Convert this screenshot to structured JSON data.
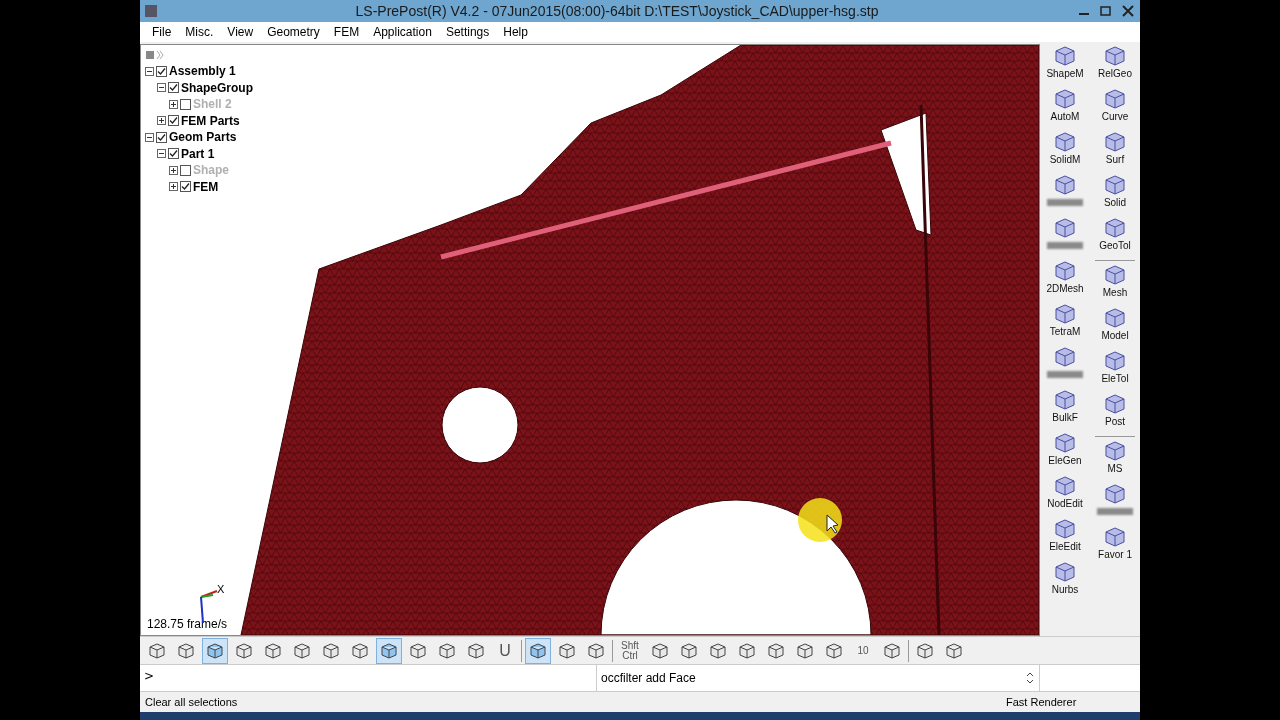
{
  "window": {
    "title": "LS-PrePost(R) V4.2 - 07Jun2015(08:00)-64bit D:\\TEST\\Joystick_CAD\\upper-hsg.stp"
  },
  "menu": [
    "File",
    "Misc.",
    "View",
    "Geometry",
    "FEM",
    "Application",
    "Settings",
    "Help"
  ],
  "tree": [
    {
      "label": "Assembly 1",
      "checked": true,
      "expanded": true,
      "children": [
        {
          "label": "ShapeGroup",
          "checked": true,
          "expanded": true,
          "children": [
            {
              "label": "Shell 2",
              "checked": false,
              "expanded": false
            }
          ]
        },
        {
          "label": "FEM Parts",
          "checked": true,
          "expanded": false
        }
      ]
    },
    {
      "label": "Geom Parts",
      "checked": true,
      "expanded": true,
      "children": [
        {
          "label": "Part 1",
          "checked": true,
          "expanded": true,
          "children": [
            {
              "label": "Shape",
              "checked": false,
              "expanded": false
            },
            {
              "label": "FEM",
              "checked": true,
              "expanded": false
            }
          ]
        }
      ]
    }
  ],
  "viewport": {
    "frame_rate": "128.75 frame/s",
    "axis_label": "X"
  },
  "tool_panel": {
    "left": [
      {
        "label": "ShapeM"
      },
      {
        "label": "AutoM"
      },
      {
        "label": "SolidM"
      },
      {
        "kind": "blurred"
      },
      {
        "kind": "blurred"
      },
      {
        "label": "2DMesh"
      },
      {
        "label": "TetraM"
      },
      {
        "kind": "blurred"
      },
      {
        "label": "BulkF"
      },
      {
        "label": "EleGen"
      },
      {
        "label": "NodEdit"
      },
      {
        "label": "EleEdit"
      },
      {
        "label": "Nurbs"
      }
    ],
    "right": [
      {
        "label": "RelGeo"
      },
      {
        "label": "Curve"
      },
      {
        "label": "Surf"
      },
      {
        "label": "Solid"
      },
      {
        "label": "GeoTol"
      },
      {
        "kind": "separator"
      },
      {
        "label": "Mesh"
      },
      {
        "label": "Model"
      },
      {
        "label": "EleTol"
      },
      {
        "label": "Post"
      },
      {
        "kind": "separator"
      },
      {
        "label": "MS"
      },
      {
        "kind": "blurred"
      },
      {
        "label": "Favor 1"
      }
    ]
  },
  "toolbar": [
    {
      "kind": "icon",
      "selected": false
    },
    {
      "kind": "icon",
      "selected": false
    },
    {
      "kind": "icon",
      "selected": true
    },
    {
      "kind": "icon",
      "selected": false
    },
    {
      "kind": "icon",
      "selected": false
    },
    {
      "kind": "icon",
      "selected": false
    },
    {
      "kind": "icon",
      "selected": false
    },
    {
      "kind": "icon",
      "selected": false
    },
    {
      "kind": "icon",
      "selected": true
    },
    {
      "kind": "icon",
      "selected": false
    },
    {
      "kind": "icon",
      "selected": false
    },
    {
      "kind": "icon",
      "selected": false
    },
    {
      "kind": "text",
      "label": "U",
      "selected": false
    },
    {
      "kind": "separator"
    },
    {
      "kind": "icon",
      "selected": true
    },
    {
      "kind": "icon",
      "selected": false
    },
    {
      "kind": "icon",
      "selected": false
    },
    {
      "kind": "separator"
    },
    {
      "kind": "text",
      "label": "Shft Ctrl",
      "selected": false
    },
    {
      "kind": "icon",
      "selected": false
    },
    {
      "kind": "icon",
      "selected": false
    },
    {
      "kind": "icon",
      "selected": false
    },
    {
      "kind": "icon",
      "selected": false
    },
    {
      "kind": "icon",
      "selected": false
    },
    {
      "kind": "icon",
      "selected": false
    },
    {
      "kind": "icon",
      "selected": false
    },
    {
      "kind": "text",
      "label": "10",
      "selected": false
    },
    {
      "kind": "icon",
      "selected": false
    },
    {
      "kind": "separator"
    },
    {
      "kind": "icon",
      "selected": false
    },
    {
      "kind": "icon",
      "selected": false
    }
  ],
  "command": {
    "prompt": ">",
    "value": "occfilter add Face"
  },
  "status_bar": {
    "message": "Clear all selections",
    "renderer": "Fast Renderer"
  }
}
